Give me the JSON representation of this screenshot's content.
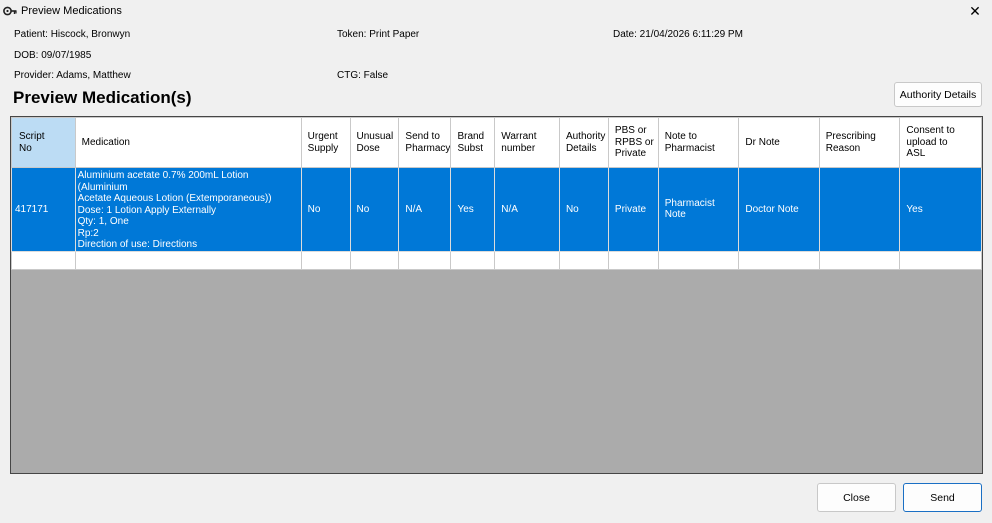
{
  "window": {
    "title": "Preview Medications"
  },
  "patient_info": {
    "patient": "Patient: Hiscock, Bronwyn",
    "token": "Token: Print Paper",
    "date": "Date: 21/04/2026 6:11:29 PM",
    "dob": "DOB: 09/07/1985",
    "provider": "Provider: Adams, Matthew",
    "ctg": "CTG: False"
  },
  "heading": "Preview Medication(s)",
  "buttons": {
    "authority_details": "Authority Details",
    "close": "Close",
    "send": "Send"
  },
  "table": {
    "columns": [
      "Script\nNo",
      "Medication",
      "Urgent\nSupply",
      "Unusual\nDose",
      "Send to\nPharmacy",
      "Brand\nSubst",
      "Warrant\nnumber",
      "Authority\nDetails",
      "PBS or\nRPBS or\nPrivate",
      "Note to\nPharmacist",
      "Dr Note",
      "Prescribing\nReason",
      "Consent to\nupload to\nASL"
    ],
    "rows": [
      {
        "script_no": "417171",
        "medication": "Aluminium acetate 0.7% 200mL Lotion (Aluminium\nAcetate Aqueous Lotion (Extemporaneous))\n  Dose: 1 Lotion Apply Externally\n  Qty: 1, One\n  Rp:2\n  Direction of use: Directions",
        "urgent_supply": "No",
        "unusual_dose": "No",
        "send_to_pharmacy": "N/A",
        "brand_subst": "Yes",
        "warrant_number": "N/A",
        "authority_details": "No",
        "pbs_rpbs_private": "Private",
        "note_to_pharmacist": "Pharmacist Note",
        "dr_note": "Doctor Note",
        "prescribing_reason": "",
        "consent_to_upload": "Yes"
      }
    ]
  },
  "colors": {
    "selection": "#0078d7",
    "header_selected": "#bcdcf4",
    "grid_background": "#ababab"
  },
  "icons": {
    "app": "key-icon",
    "close": "close-icon"
  }
}
